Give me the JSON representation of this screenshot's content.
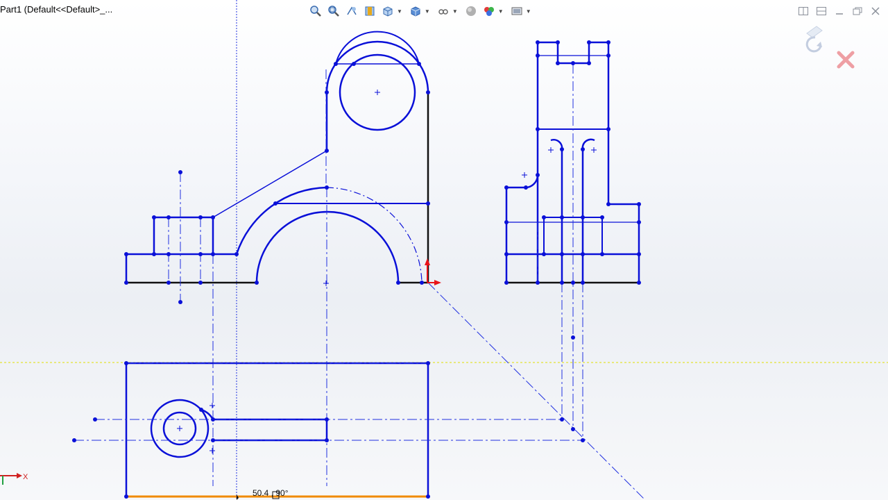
{
  "window": {
    "title": "Part1  (Default<<Default>_..."
  },
  "toolbar": {
    "buttons": [
      {
        "name": "zoom-to-fit",
        "icon": "zoom-fit-icon"
      },
      {
        "name": "zoom-to-area",
        "icon": "zoom-area-icon"
      },
      {
        "name": "previous-view",
        "icon": "previous-view-icon"
      },
      {
        "name": "section-view",
        "icon": "section-view-icon"
      },
      {
        "name": "view-orientation",
        "icon": "view-orientation-icon"
      },
      {
        "name": "display-style",
        "icon": "display-style-icon"
      },
      {
        "name": "hide-show-items",
        "icon": "hide-show-icon"
      },
      {
        "name": "edit-appearance",
        "icon": "appearance-icon"
      },
      {
        "name": "apply-scene",
        "icon": "scene-icon"
      },
      {
        "name": "view-settings",
        "icon": "view-settings-icon"
      }
    ]
  },
  "colors": {
    "sketch_blue": "#0a10d8",
    "fixed_black": "#111111",
    "selected_orange": "#f08a00",
    "origin_red": "#e8141a",
    "guide_yellow": "#e8e800"
  },
  "sketch": {
    "dimension_label": "50.4 , 90°"
  },
  "axis": {
    "x_label": "X"
  }
}
